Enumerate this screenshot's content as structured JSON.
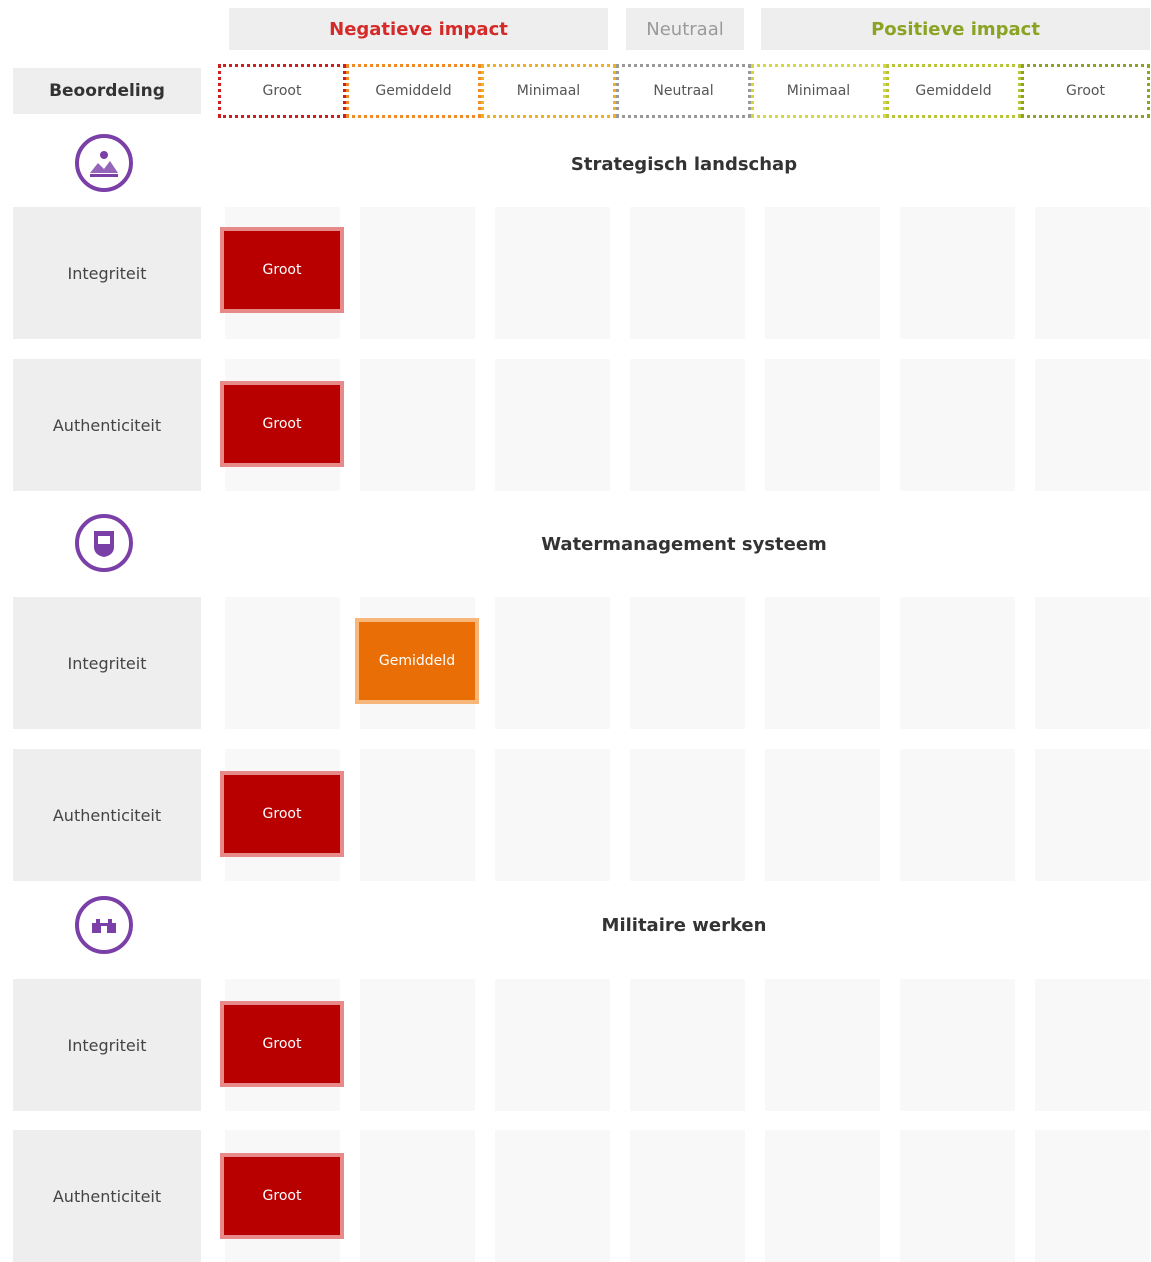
{
  "header": {
    "negative": "Negatieve impact",
    "neutral": "Neutraal",
    "positive": "Positieve impact"
  },
  "scale": {
    "label": "Beoordeling",
    "levels": [
      "Groot",
      "Gemiddeld",
      "Minimaal",
      "Neutraal",
      "Minimaal",
      "Gemiddeld",
      "Groot"
    ],
    "border_colors": [
      "#cc1f1f",
      "#f08a24",
      "#f0b020",
      "#999999",
      "#d6d640",
      "#b8c43a",
      "#8aa323"
    ]
  },
  "colors": {
    "groot": "#b80000",
    "gemiddeld": "#e86e05",
    "icon": "#7b3fa8",
    "negative_text": "#d42a2a",
    "positive_text": "#8aa323"
  },
  "sections": [
    {
      "title": "Strategisch landschap",
      "icon": "landscape-icon",
      "rows": [
        {
          "label": "Integriteit",
          "rating": "Groot",
          "level_index": 0
        },
        {
          "label": "Authenticiteit",
          "rating": "Groot",
          "level_index": 0
        }
      ]
    },
    {
      "title": "Watermanagement systeem",
      "icon": "water-system-icon",
      "rows": [
        {
          "label": "Integriteit",
          "rating": "Gemiddeld",
          "level_index": 1
        },
        {
          "label": "Authenticiteit",
          "rating": "Groot",
          "level_index": 0
        }
      ]
    },
    {
      "title": "Militaire werken",
      "icon": "military-works-icon",
      "rows": [
        {
          "label": "Integriteit",
          "rating": "Groot",
          "level_index": 0
        },
        {
          "label": "Authenticiteit",
          "rating": "Groot",
          "level_index": 0
        }
      ]
    }
  ]
}
